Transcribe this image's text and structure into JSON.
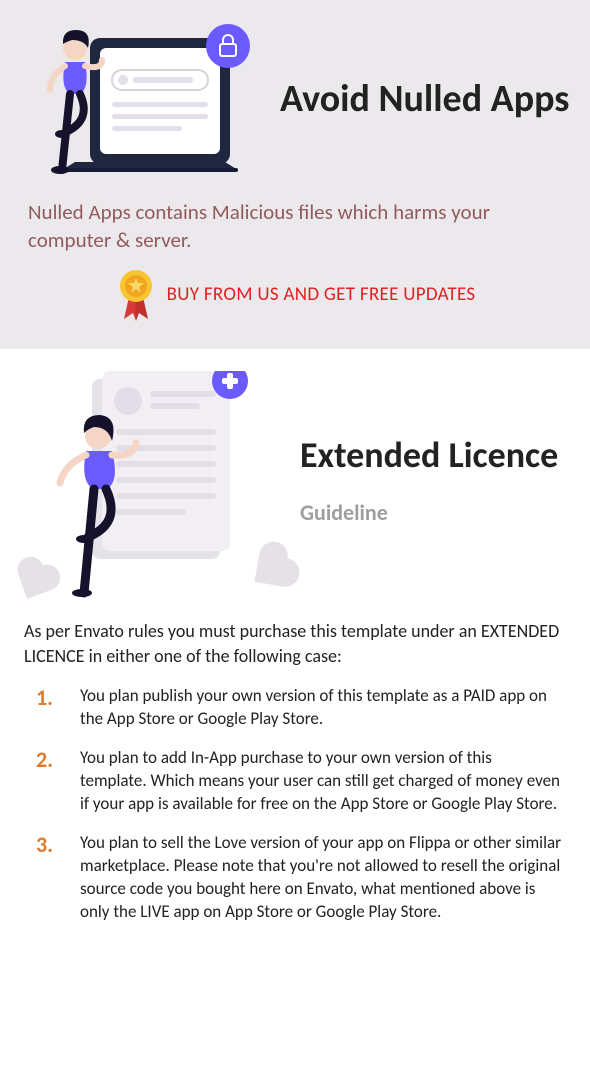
{
  "section1": {
    "title": "Avoid Nulled Apps",
    "warning": "Nulled Apps contains Malicious files which harms your computer & server.",
    "cta": "BUY FROM US AND GET FREE UPDATES"
  },
  "section2": {
    "title": "Extended Licence",
    "subtitle": "Guideline",
    "intro": "As per Envato rules you must purchase this template under an EXTENDED LICENCE in either one of the following case:",
    "rules": [
      "You plan publish your own version of this template as a PAID app on the App Store or Google Play Store.",
      "You plan to add In-App purchase to your own version of this template. Which means your user can still get charged of money even if your app is available for free on the App Store or Google Play Store.",
      "You plan to sell the Love version of your app on Flippa or other similar marketplace. Please note that you're not allowed to resell the original source code you bought here on Envato, what mentioned above is only the LIVE app on App Store or Google Play Store."
    ]
  }
}
